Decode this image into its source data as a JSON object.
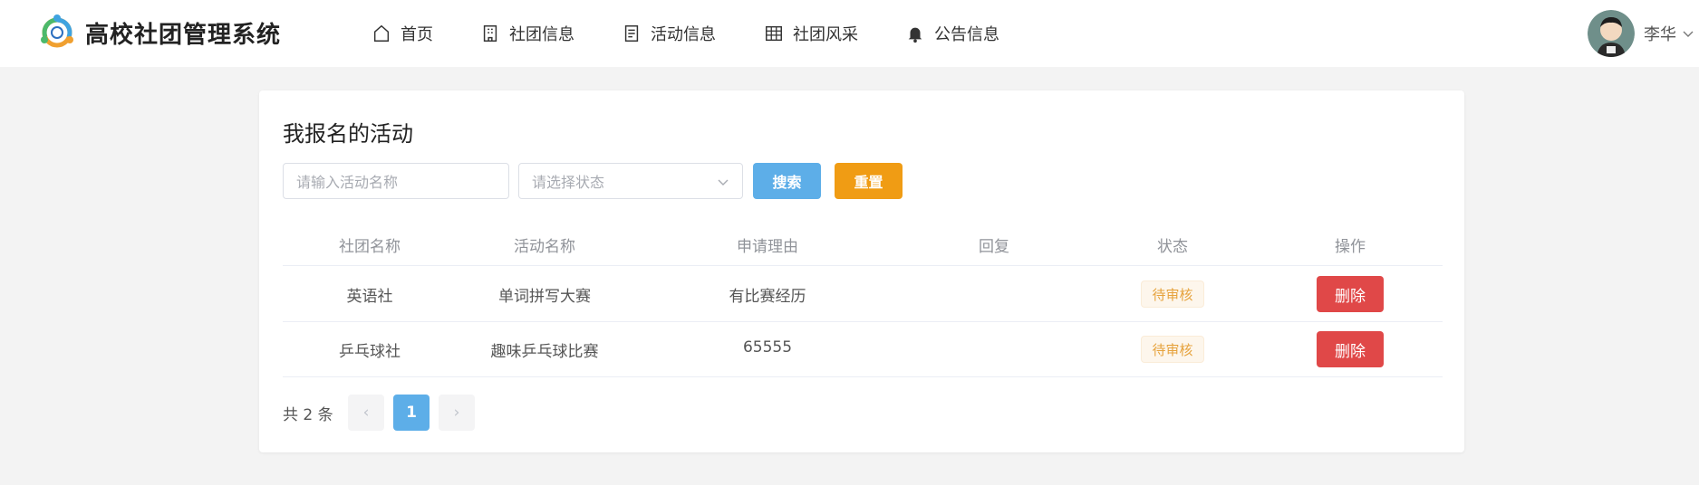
{
  "app": {
    "title": "高校社团管理系统"
  },
  "nav": [
    {
      "label": "首页",
      "icon": "home-icon"
    },
    {
      "label": "社团信息",
      "icon": "building-icon"
    },
    {
      "label": "活动信息",
      "icon": "document-icon"
    },
    {
      "label": "社团风采",
      "icon": "grid-icon"
    },
    {
      "label": "公告信息",
      "icon": "bell-icon"
    }
  ],
  "user": {
    "name": "李华"
  },
  "page": {
    "title": "我报名的活动"
  },
  "search": {
    "name_placeholder": "请输入活动名称",
    "status_placeholder": "请选择状态",
    "search_label": "搜索",
    "reset_label": "重置"
  },
  "table": {
    "columns": [
      "社团名称",
      "活动名称",
      "申请理由",
      "回复",
      "状态",
      "操作"
    ],
    "rows": [
      {
        "club": "英语社",
        "activity": "单词拼写大赛",
        "reason": "有比赛经历",
        "reply": "",
        "status": "待审核",
        "action": "删除"
      },
      {
        "club": "乒乓球社",
        "activity": "趣味乒乓球比赛",
        "reason": "65555",
        "reply": "",
        "status": "待审核",
        "action": "删除"
      }
    ]
  },
  "pagination": {
    "total_text": "共 2 条",
    "prev": "‹",
    "current": "1",
    "next": "›"
  },
  "colors": {
    "primary": "#5daee8",
    "reset": "#f09c14",
    "danger": "#e04848",
    "warning_tag_text": "#e6a23c",
    "warning_tag_bg": "#fdf6ec"
  }
}
